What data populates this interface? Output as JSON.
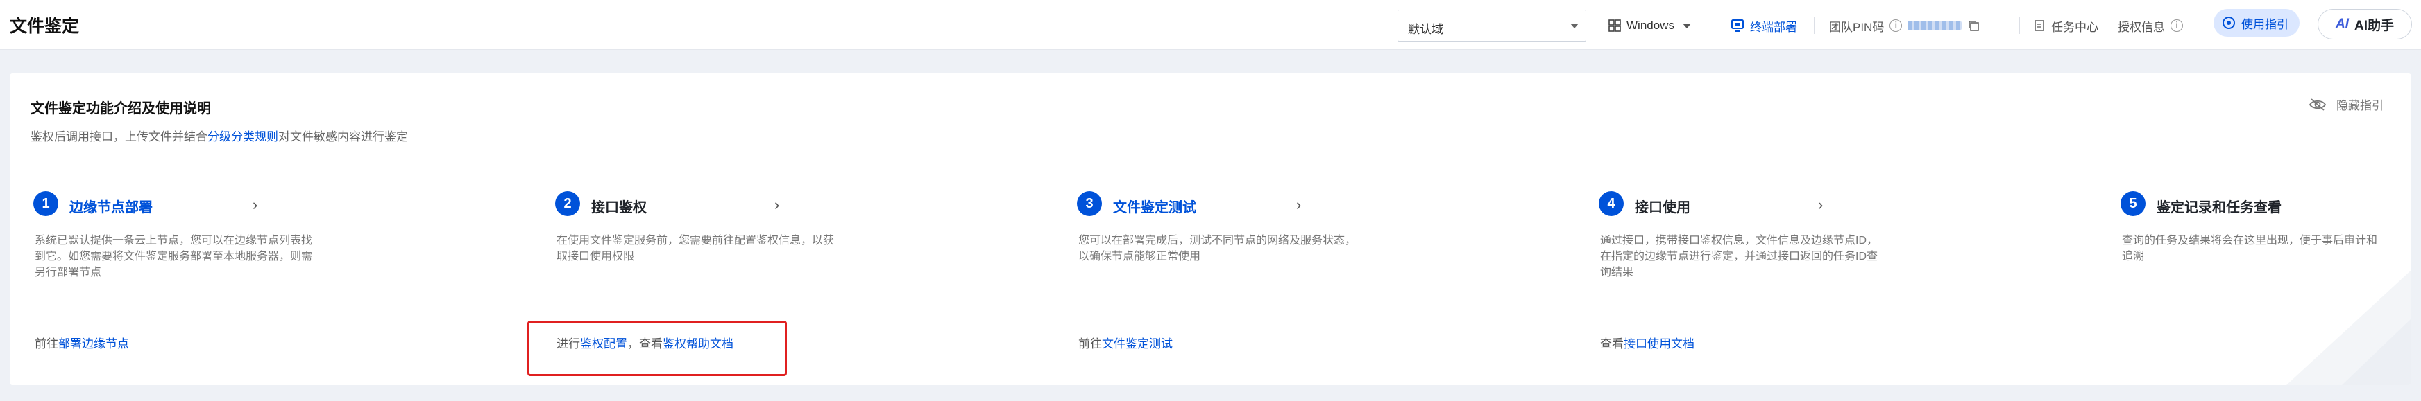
{
  "header": {
    "title": "文件鉴定",
    "domain_select": "默认域",
    "os_select": "Windows",
    "terminal_deploy": "终端部署",
    "team_pin_label": "团队PIN码",
    "task_center": "任务中心",
    "license_info": "授权信息",
    "guide_button": "使用指引",
    "ai_button": "AI助手",
    "ai_logo": "AI"
  },
  "card": {
    "title": "文件鉴定功能介绍及使用说明",
    "subtitle_prefix": "鉴权后调用接口，上传文件并结合",
    "subtitle_link": "分级分类规则",
    "subtitle_suffix": "对文件敏感内容进行鉴定",
    "hide_guide": "隐藏指引"
  },
  "steps": [
    {
      "num": "1",
      "title": "边缘节点部署",
      "desc": "系统已默认提供一条云上节点，您可以在边缘节点列表找到它。如您需要将文件鉴定服务部署至本地服务器，则需另行部署节点",
      "link_prefix": "前往",
      "link1": "部署边缘节点"
    },
    {
      "num": "2",
      "title": "接口鉴权",
      "desc": "在使用文件鉴定服务前，您需要前往配置鉴权信息，以获取接口使用权限",
      "link_prefix": "进行",
      "link1": "鉴权配置",
      "link_mid": "，查看",
      "link2": "鉴权帮助文档"
    },
    {
      "num": "3",
      "title": "文件鉴定测试",
      "desc": "您可以在部署完成后，测试不同节点的网络及服务状态，以确保节点能够正常使用",
      "link_prefix": "前往",
      "link1": "文件鉴定测试"
    },
    {
      "num": "4",
      "title": "接口使用",
      "desc": "通过接口，携带接口鉴权信息，文件信息及边缘节点ID，在指定的边缘节点进行鉴定，并通过接口返回的任务ID查询结果",
      "link_prefix": "查看",
      "link1": "接口使用文档"
    },
    {
      "num": "5",
      "title": "鉴定记录和任务查看",
      "desc": "查询的任务及结果将会在这里出现，便于事后审计和追溯"
    }
  ],
  "colors": {
    "primary": "#0052d9",
    "highlight": "#e02020"
  }
}
